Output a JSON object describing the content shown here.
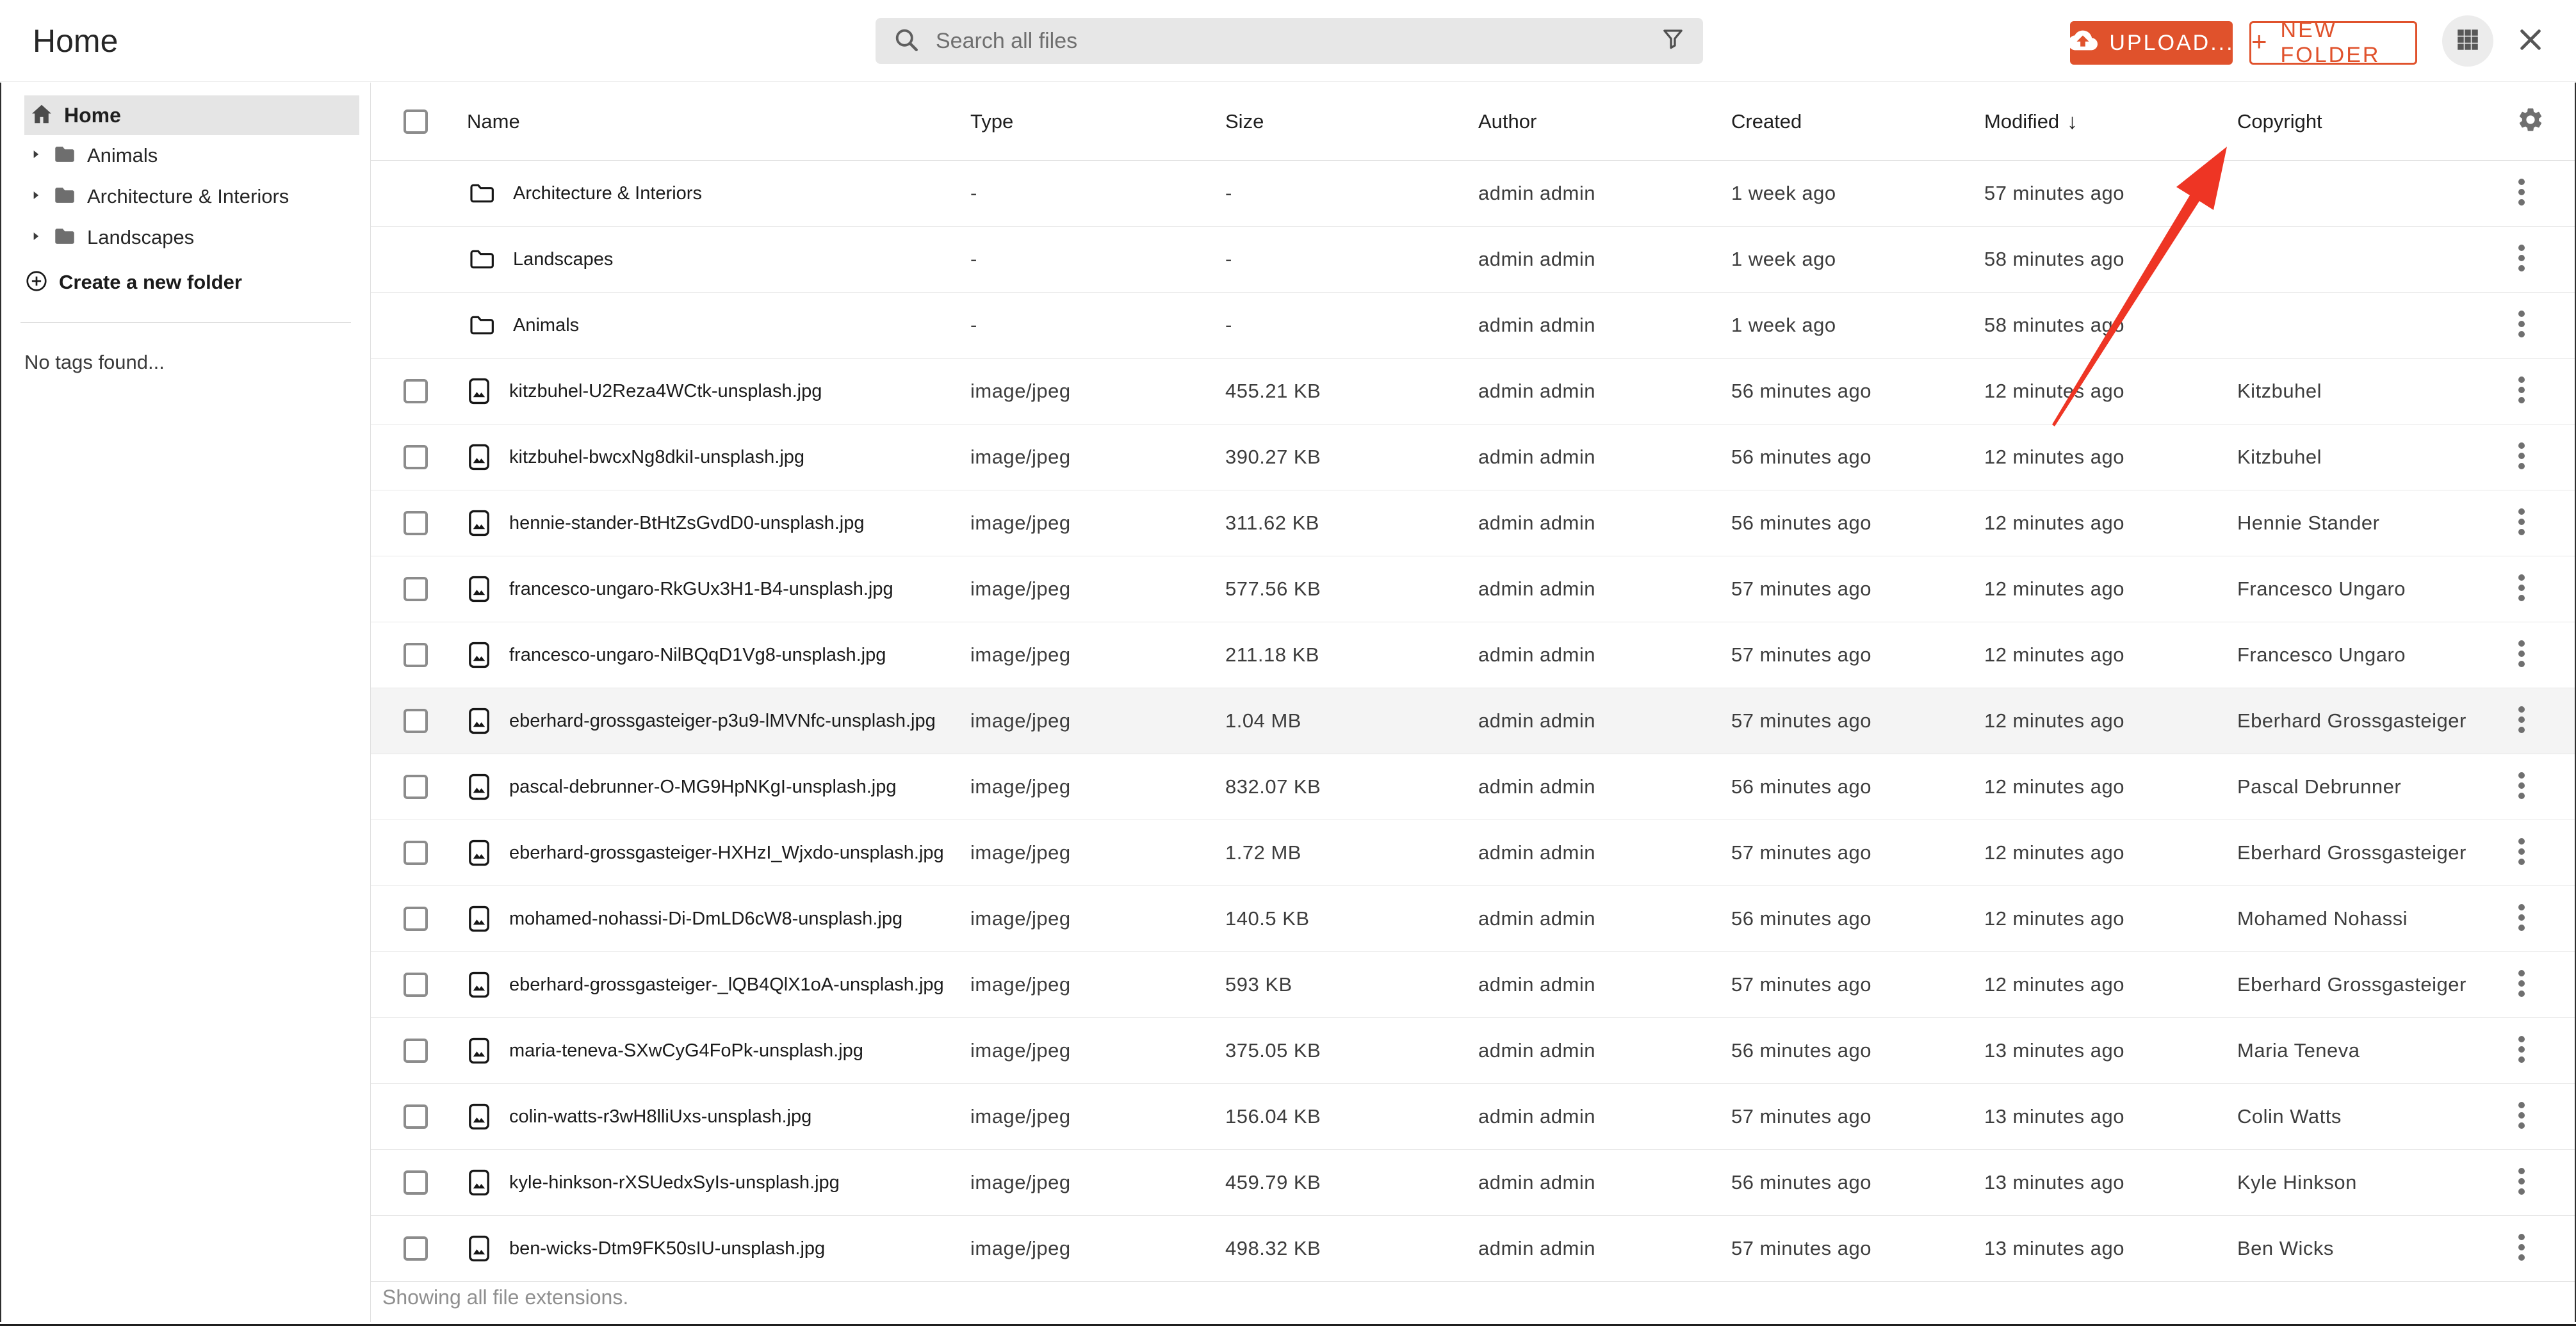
{
  "topbar": {
    "title": "Home",
    "search_placeholder": "Search all files",
    "upload_label": "UPLOAD...",
    "new_folder_label": "NEW FOLDER"
  },
  "sidebar": {
    "home_label": "Home",
    "tree": [
      {
        "label": "Animals"
      },
      {
        "label": "Architecture & Interiors"
      },
      {
        "label": "Landscapes"
      }
    ],
    "create_folder_label": "Create a new folder",
    "no_tags_label": "No tags found..."
  },
  "table": {
    "columns": [
      {
        "label": "Name"
      },
      {
        "label": "Type"
      },
      {
        "label": "Size"
      },
      {
        "label": "Author"
      },
      {
        "label": "Created"
      },
      {
        "label": "Modified"
      },
      {
        "label": "Copyright"
      }
    ],
    "sort": {
      "column": "Modified",
      "indicator": "↓"
    },
    "rows": [
      {
        "kind": "folder",
        "name": "Architecture & Interiors",
        "type": "-",
        "size": "-",
        "author": "admin admin",
        "created": "1 week ago",
        "modified": "57 minutes ago",
        "copyright": "",
        "highlighted": false
      },
      {
        "kind": "folder",
        "name": "Landscapes",
        "type": "-",
        "size": "-",
        "author": "admin admin",
        "created": "1 week ago",
        "modified": "58 minutes ago",
        "copyright": "",
        "highlighted": false
      },
      {
        "kind": "folder",
        "name": "Animals",
        "type": "-",
        "size": "-",
        "author": "admin admin",
        "created": "1 week ago",
        "modified": "58 minutes ago",
        "copyright": "",
        "highlighted": false
      },
      {
        "kind": "file",
        "name": "kitzbuhel-U2Reza4WCtk-unsplash.jpg",
        "type": "image/jpeg",
        "size": "455.21 KB",
        "author": "admin admin",
        "created": "56 minutes ago",
        "modified": "12 minutes ago",
        "copyright": "Kitzbuhel",
        "highlighted": false
      },
      {
        "kind": "file",
        "name": "kitzbuhel-bwcxNg8dkiI-unsplash.jpg",
        "type": "image/jpeg",
        "size": "390.27 KB",
        "author": "admin admin",
        "created": "56 minutes ago",
        "modified": "12 minutes ago",
        "copyright": "Kitzbuhel",
        "highlighted": false
      },
      {
        "kind": "file",
        "name": "hennie-stander-BtHtZsGvdD0-unsplash.jpg",
        "type": "image/jpeg",
        "size": "311.62 KB",
        "author": "admin admin",
        "created": "56 minutes ago",
        "modified": "12 minutes ago",
        "copyright": "Hennie Stander",
        "highlighted": false
      },
      {
        "kind": "file",
        "name": "francesco-ungaro-RkGUx3H1-B4-unsplash.jpg",
        "type": "image/jpeg",
        "size": "577.56 KB",
        "author": "admin admin",
        "created": "57 minutes ago",
        "modified": "12 minutes ago",
        "copyright": "Francesco Ungaro",
        "highlighted": false
      },
      {
        "kind": "file",
        "name": "francesco-ungaro-NilBQqD1Vg8-unsplash.jpg",
        "type": "image/jpeg",
        "size": "211.18 KB",
        "author": "admin admin",
        "created": "57 minutes ago",
        "modified": "12 minutes ago",
        "copyright": "Francesco Ungaro",
        "highlighted": false
      },
      {
        "kind": "file",
        "name": "eberhard-grossgasteiger-p3u9-lMVNfc-unsplash.jpg",
        "type": "image/jpeg",
        "size": "1.04 MB",
        "author": "admin admin",
        "created": "57 minutes ago",
        "modified": "12 minutes ago",
        "copyright": "Eberhard Grossgasteiger",
        "highlighted": true
      },
      {
        "kind": "file",
        "name": "pascal-debrunner-O-MG9HpNKgI-unsplash.jpg",
        "type": "image/jpeg",
        "size": "832.07 KB",
        "author": "admin admin",
        "created": "56 minutes ago",
        "modified": "12 minutes ago",
        "copyright": "Pascal Debrunner",
        "highlighted": false
      },
      {
        "kind": "file",
        "name": "eberhard-grossgasteiger-HXHzI_Wjxdo-unsplash.jpg",
        "type": "image/jpeg",
        "size": "1.72 MB",
        "author": "admin admin",
        "created": "57 minutes ago",
        "modified": "12 minutes ago",
        "copyright": "Eberhard Grossgasteiger",
        "highlighted": false
      },
      {
        "kind": "file",
        "name": "mohamed-nohassi-Di-DmLD6cW8-unsplash.jpg",
        "type": "image/jpeg",
        "size": "140.5 KB",
        "author": "admin admin",
        "created": "56 minutes ago",
        "modified": "12 minutes ago",
        "copyright": "Mohamed Nohassi",
        "highlighted": false
      },
      {
        "kind": "file",
        "name": "eberhard-grossgasteiger-_lQB4QlX1oA-unsplash.jpg",
        "type": "image/jpeg",
        "size": "593 KB",
        "author": "admin admin",
        "created": "57 minutes ago",
        "modified": "12 minutes ago",
        "copyright": "Eberhard Grossgasteiger",
        "highlighted": false
      },
      {
        "kind": "file",
        "name": "maria-teneva-SXwCyG4FoPk-unsplash.jpg",
        "type": "image/jpeg",
        "size": "375.05 KB",
        "author": "admin admin",
        "created": "56 minutes ago",
        "modified": "13 minutes ago",
        "copyright": "Maria Teneva",
        "highlighted": false
      },
      {
        "kind": "file",
        "name": "colin-watts-r3wH8lliUxs-unsplash.jpg",
        "type": "image/jpeg",
        "size": "156.04 KB",
        "author": "admin admin",
        "created": "57 minutes ago",
        "modified": "13 minutes ago",
        "copyright": "Colin Watts",
        "highlighted": false
      },
      {
        "kind": "file",
        "name": "kyle-hinkson-rXSUedxSyIs-unsplash.jpg",
        "type": "image/jpeg",
        "size": "459.79 KB",
        "author": "admin admin",
        "created": "56 minutes ago",
        "modified": "13 minutes ago",
        "copyright": "Kyle Hinkson",
        "highlighted": false
      },
      {
        "kind": "file",
        "name": "ben-wicks-Dtm9FK50sIU-unsplash.jpg",
        "type": "image/jpeg",
        "size": "498.32 KB",
        "author": "admin admin",
        "created": "57 minutes ago",
        "modified": "13 minutes ago",
        "copyright": "Ben Wicks",
        "highlighted": false
      }
    ],
    "footer": "Showing all file extensions."
  },
  "colors": {
    "accent": "#e0522c",
    "row_highlight": "#f4f4f4",
    "annotation_arrow": "#ee3524",
    "sidebar_selected": "#e5e5e5"
  }
}
